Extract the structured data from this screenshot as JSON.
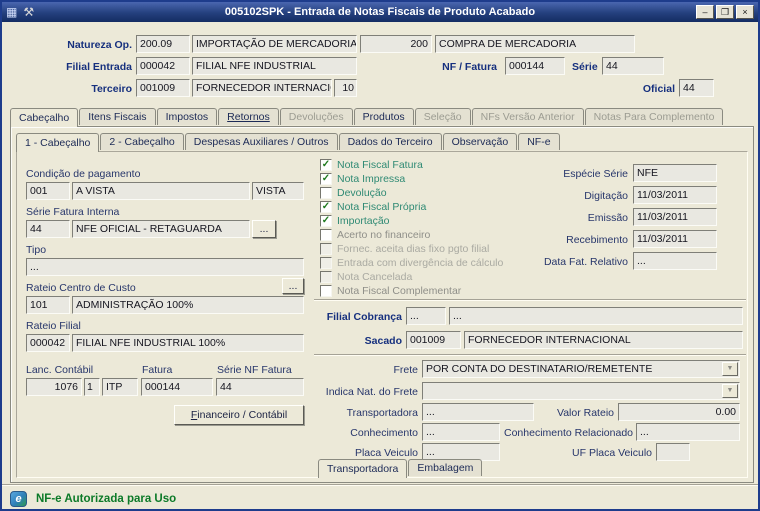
{
  "window": {
    "title": "005102SPK - Entrada de Notas Fiscais de Produto Acabado",
    "minimize": "–",
    "maximize": "❐",
    "close": "×"
  },
  "icons": {
    "grid": "▦",
    "tools": "⚒",
    "dropdown": "▼",
    "nfe": "e"
  },
  "header": {
    "natureza": {
      "label": "Natureza Op.",
      "code": "200.09",
      "desc": "IMPORTAÇÃO DE MERCADORIAS",
      "code2": "200",
      "desc2": "COMPRA DE MERCADORIA"
    },
    "filial": {
      "label": "Filial Entrada",
      "code": "000042",
      "desc": "FILIAL NFE INDUSTRIAL"
    },
    "nf": {
      "label": "NF / Fatura",
      "value": "000144"
    },
    "serie": {
      "label": "Série",
      "value": "44"
    },
    "terceiro": {
      "label": "Terceiro",
      "code": "001009",
      "desc": "FORNECEDOR INTERNACIONAL",
      "loja": "10"
    },
    "oficial": {
      "label": "Oficial",
      "value": "44"
    }
  },
  "tabs": [
    {
      "label": "Cabeçalho"
    },
    {
      "label": "Itens Fiscais"
    },
    {
      "label": "Impostos"
    },
    {
      "label": "Retornos"
    },
    {
      "label": "Devoluções"
    },
    {
      "label": "Produtos"
    },
    {
      "label": "Seleção"
    },
    {
      "label": "NFs Versão Anterior"
    },
    {
      "label": "Notas Para Complemento"
    }
  ],
  "subtabs": [
    {
      "label": "1 - Cabeçalho"
    },
    {
      "label": "2 - Cabeçalho"
    },
    {
      "label": "Despesas Auxiliares / Outros"
    },
    {
      "label": "Dados do Terceiro"
    },
    {
      "label": "Observação"
    },
    {
      "label": "NF-e"
    }
  ],
  "payment": {
    "label": "Condição de pagamento",
    "code": "001",
    "desc": "A VISTA",
    "tipo": "VISTA"
  },
  "serie_fatura": {
    "label": "Série Fatura Interna",
    "code": "44",
    "desc": "NFE OFICIAL - RETAGUARDA",
    "browse": "..."
  },
  "tipo": {
    "label": "Tipo",
    "value": "..."
  },
  "rateio_cc": {
    "label": "Rateio Centro de Custo",
    "browse": "...",
    "code": "101",
    "desc": "ADMINISTRAÇÃO 100%"
  },
  "rateio_filial": {
    "label": "Rateio Filial",
    "code": "000042",
    "desc": "FILIAL NFE INDUSTRIAL 100%"
  },
  "contabil": {
    "lanc_label": "Lanc. Contábil",
    "fatura_label": "Fatura",
    "serie_label": "Série NF Fatura",
    "lanc": "1076",
    "seq": "1",
    "tipo": "ITP",
    "fatura": "000144",
    "serie": "44",
    "button": "Financeiro / Contábil"
  },
  "checkboxes": [
    {
      "label": "Nota Fiscal Fatura",
      "mark": "✓"
    },
    {
      "label": "Nota Impressa",
      "mark": "✓"
    },
    {
      "label": "Devolução",
      "mark": ""
    },
    {
      "label": "Nota Fiscal Própria",
      "mark": "✓"
    },
    {
      "label": "Importação",
      "mark": "✓"
    },
    {
      "label": "Acerto no financeiro",
      "mark": ""
    },
    {
      "label": "Fornec. aceita dias fixo pgto filial",
      "mark": ""
    },
    {
      "label": "Entrada com divergência de cálculo",
      "mark": ""
    },
    {
      "label": "Nota Cancelada",
      "mark": ""
    },
    {
      "label": "Nota Fiscal Complementar",
      "mark": ""
    }
  ],
  "dates": {
    "especie_label": "Espécie Série",
    "especie": "NFE",
    "digitacao_label": "Digitação",
    "digitacao": "11/03/2011",
    "emissao_label": "Emissão",
    "emissao": "11/03/2011",
    "recebimento_label": "Recebimento",
    "recebimento": "11/03/2011",
    "fat_relativo_label": "Data Fat. Relativo",
    "fat_relativo": "..."
  },
  "cobranca": {
    "filial_label": "Filial Cobrança",
    "filial_code": "...",
    "filial_desc": "...",
    "sacado_label": "Sacado",
    "sacado_code": "001009",
    "sacado_desc": "FORNECEDOR INTERNACIONAL"
  },
  "frete": {
    "frete_label": "Frete",
    "frete_value": "POR CONTA DO DESTINATARIO/REMETENTE",
    "indica_label": "Indica Nat. do Frete",
    "indica_value": "",
    "transportadora_label": "Transportadora",
    "transportadora_value": "...",
    "valor_rateio_label": "Valor Rateio",
    "valor_rateio": "0.00",
    "conhecimento_label": "Conhecimento",
    "conhecimento_value": "...",
    "conhecimento_rel_label": "Conhecimento Relacionado",
    "conhecimento_rel_value": "...",
    "placa_label": "Placa Veiculo",
    "placa_value": "...",
    "uf_placa_label": "UF Placa Veiculo",
    "uf_placa_value": ""
  },
  "bottom_tabs": [
    {
      "label": "Transportadora"
    },
    {
      "label": "Embalagem"
    }
  ],
  "status": {
    "message": "NF-e Autorizada para Uso"
  }
}
